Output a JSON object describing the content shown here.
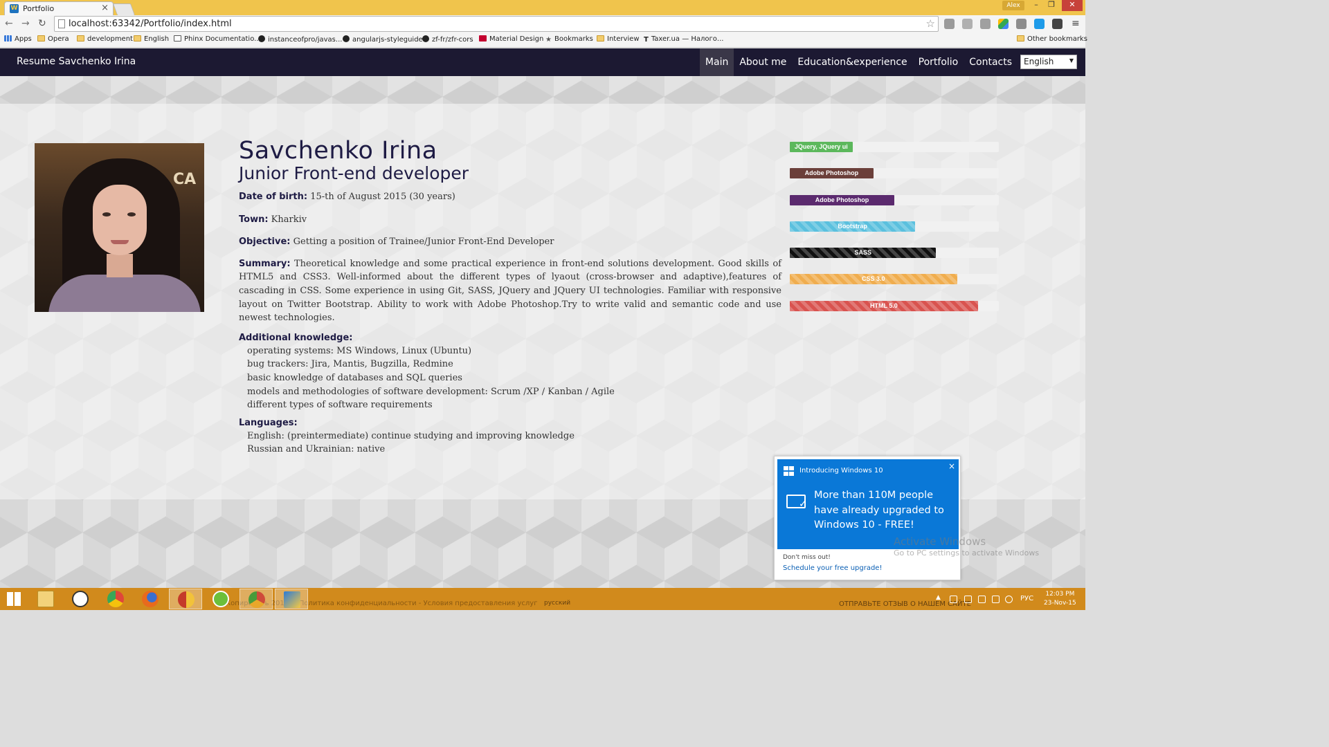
{
  "browser": {
    "tab_title": "Portfolio",
    "tab_favicon": "W",
    "tab_close": "×",
    "user_badge": "Alex",
    "window_controls": {
      "minimize": "–",
      "restore": "❐",
      "close": "✕"
    },
    "url": "localhost:63342/Portfolio/index.html",
    "bookmarks": [
      {
        "label": "Apps",
        "icon": "apps-icon"
      },
      {
        "label": "Opera",
        "icon": "folder-icon"
      },
      {
        "label": "development",
        "icon": "folder-icon"
      },
      {
        "label": "English",
        "icon": "folder-icon"
      },
      {
        "label": "Phinx Documentatio...",
        "icon": "doc-icon"
      },
      {
        "label": "instanceofpro/javas...",
        "icon": "github-icon"
      },
      {
        "label": "angularjs-styleguide",
        "icon": "github-icon"
      },
      {
        "label": "zf-fr/zfr-cors",
        "icon": "github-icon"
      },
      {
        "label": "Material Design",
        "icon": "angular-icon"
      },
      {
        "label": "Bookmarks",
        "icon": "star-icon"
      },
      {
        "label": "Interview",
        "icon": "folder-icon"
      },
      {
        "label": "Taxer.ua — Налого...",
        "icon": "taxer-icon"
      }
    ],
    "other_bookmarks": "Other bookmarks"
  },
  "site": {
    "brand": "Resume Savchenko Irina",
    "menu": [
      {
        "label": "Main",
        "active": true
      },
      {
        "label": "About me",
        "active": false
      },
      {
        "label": "Education&experience",
        "active": false
      },
      {
        "label": "Portfolio",
        "active": false
      },
      {
        "label": "Contacts",
        "active": false
      }
    ],
    "language": "English",
    "photo_sign": "CA"
  },
  "profile": {
    "name": "Savchenko Irina",
    "position": "Junior Front-end developer",
    "dob_label": "Date of birth:",
    "dob_value": " 15-th of August 2015 (30 years)",
    "town_label": "Town:",
    "town_value": " Kharkiv",
    "objective_label": "Objective:",
    "objective_value": " Getting a position of Trainee/Junior Front-End Developer",
    "summary_label": "Summary:",
    "summary_value": " Theoretical knowledge and some practical experience in front-end solutions development. Good skills of HTML5 and CSS3. Well-informed about the different types of lyaout (cross-browser and adaptive),features of cascading in CSS. Some experience in using Git, SASS, JQuery and JQuery UI technologies. Familiar with responsive layout on Twitter Bootstrap. Ability to work with Adobe Photoshop.Try to write valid and semantic code and use newest technologies.",
    "additional_label": "Additional knowledge:",
    "additional_items": [
      "operating systems: MS Windows, Linux (Ubuntu)",
      "bug trackers: Jira, Mantis, Bugzilla, Redmine",
      "basic knowledge of databases and SQL queries",
      "models and methodologies of software development: Scrum /XP / Kanban / Agile",
      "different types of software requirements"
    ],
    "languages_label": "Languages:",
    "languages_items": [
      "English: (preintermediate) continue studying and improving knowledge",
      "Russian and Ukrainian: native"
    ]
  },
  "skills": [
    {
      "label": "JQuery, JQuery ui",
      "level": 0.3,
      "color": "#5cb85c",
      "striped": false
    },
    {
      "label": "Adobe Photoshop",
      "level": 0.4,
      "color": "#6b3f3a",
      "striped": false
    },
    {
      "label": "Adobe Photoshop",
      "level": 0.5,
      "color": "#5b2a6e",
      "striped": false
    },
    {
      "label": "Bootstrap",
      "level": 0.6,
      "color": "#5bc0de",
      "striped": true
    },
    {
      "label": "SASS",
      "level": 0.7,
      "color": "#111111",
      "striped": true
    },
    {
      "label": "CSS 3.0",
      "level": 0.8,
      "color": "#f0ad4e",
      "striped": true
    },
    {
      "label": "HTML 5.0",
      "level": 0.9,
      "color": "#d9534f",
      "striped": true
    }
  ],
  "toast": {
    "header": "Introducing Windows 10",
    "close": "×",
    "message": "More than 110M people have already upgraded to Windows 10 - FREE!",
    "dont_miss": "Don't miss out!",
    "link": "Schedule your free upgrade!"
  },
  "watermark": {
    "title": "Activate Windows",
    "subtitle": "Go to PC settings to activate Windows"
  },
  "taskbar": {
    "faded_text": "Копировать 2015 г. Политика конфиденциальности - Условия предоставления услуг",
    "locale_hint": "русский",
    "feedback": "ОТПРАВЬТЕ ОТЗЫВ О НАШЕМ САЙТЕ",
    "input_lang": "РУС",
    "time": "12:03 PM",
    "date": "23-Nov-15",
    "apps": [
      {
        "name": "start-icon",
        "color": "#ffffff"
      },
      {
        "name": "file-explorer-icon",
        "color": "#f3d27a"
      },
      {
        "name": "fox-icon",
        "color": "#ffffff"
      },
      {
        "name": "chrome-icon",
        "color": "#e0463a"
      },
      {
        "name": "firefox-icon",
        "color": "#e86a1d"
      },
      {
        "name": "chrome-user-icon",
        "color": "#f2c23a"
      },
      {
        "name": "utorrent-icon",
        "color": "#6cbf3a"
      },
      {
        "name": "chrome-canary-icon",
        "color": "#cf4b3a"
      },
      {
        "name": "webstorm-icon",
        "color": "#2b7bd8"
      }
    ]
  }
}
